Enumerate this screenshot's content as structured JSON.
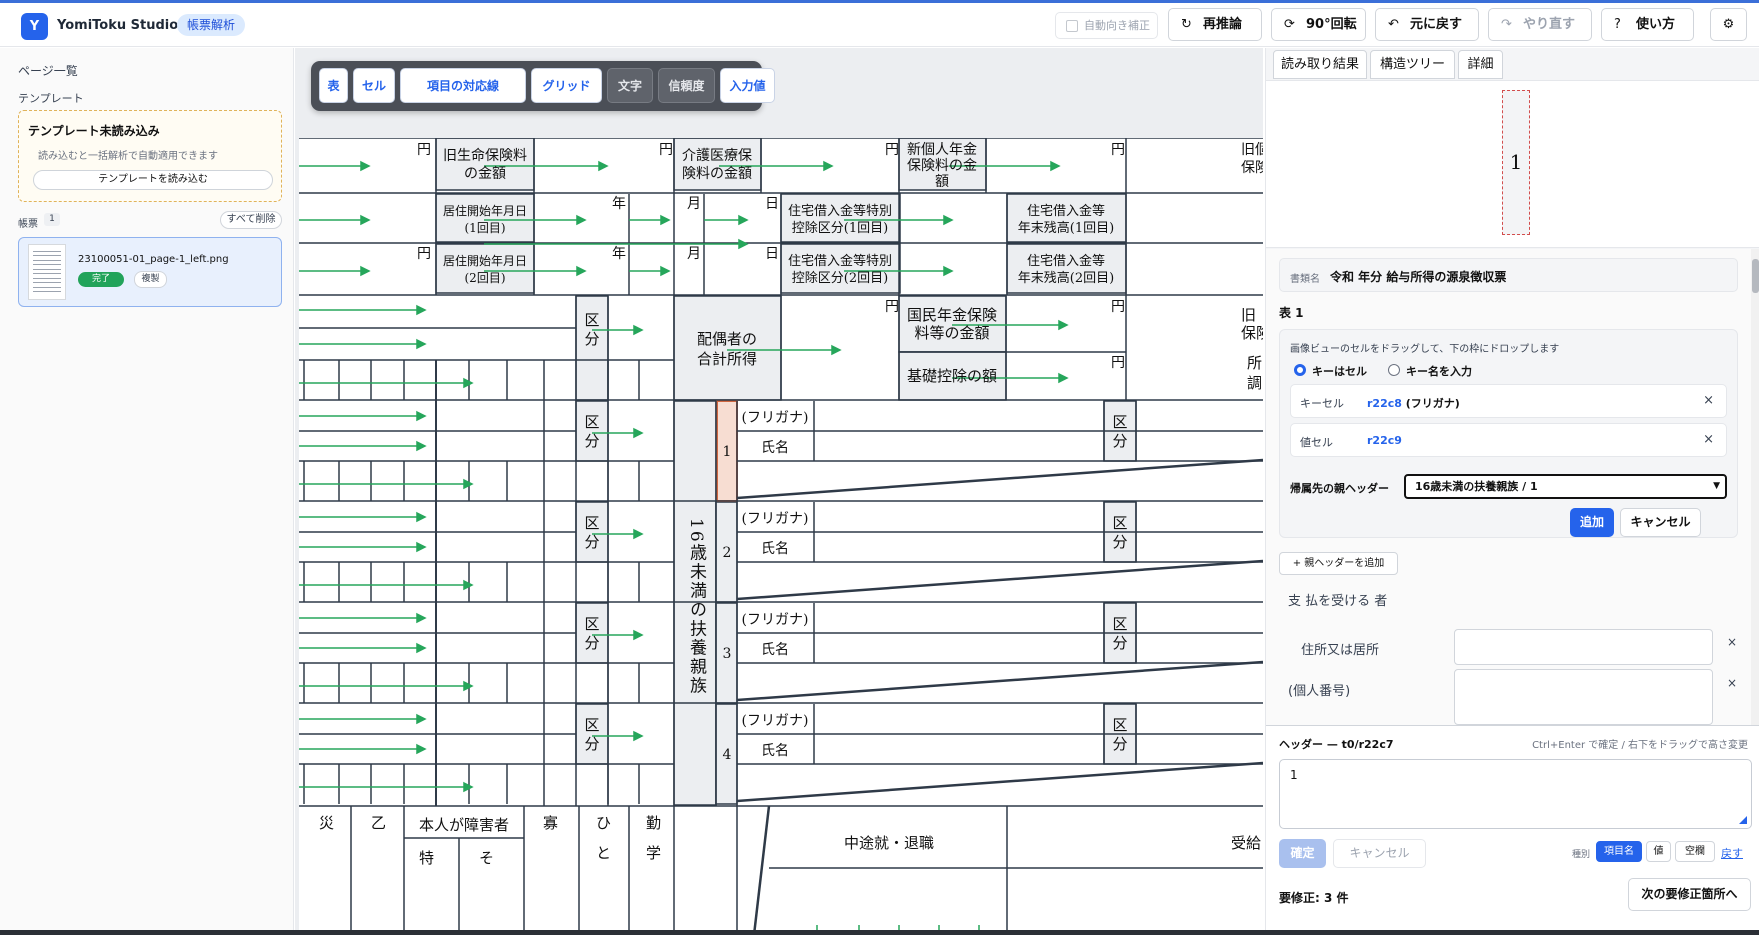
{
  "app": {
    "logo": "Y",
    "title": "YomiToku Studio",
    "mode": "帳票解析"
  },
  "toolbar": {
    "auto_rotate": "自動向き補正",
    "reinfer": "再推論",
    "reinfer_icon": "↻",
    "rotate": "90°回転",
    "rotate_icon": "⟳",
    "undo": "元に戻す",
    "undo_icon": "↶",
    "redo": "やり直す",
    "redo_icon": "↷",
    "help": "使い方",
    "help_icon": "?",
    "settings_icon": "⚙"
  },
  "left": {
    "page_list": "ページ一覧",
    "template_heading": "テンプレート",
    "template_title": "テンプレート未読み込み",
    "template_desc": "読み込むと一括解析で自動適用できます",
    "template_load": "テンプレートを読み込む",
    "forms_label": "帳票",
    "forms_count": "1",
    "clear_all": "すべて削除",
    "file": {
      "name": "23100051-01_page-1_left.png",
      "status": "完了",
      "duplicate": "複製"
    }
  },
  "overlay": [
    "表",
    "セル",
    "項目の対応線",
    "グリッド",
    "文字",
    "信頼度",
    "入力値"
  ],
  "doc": {
    "yen": "円",
    "year": "年",
    "month": "月",
    "day": "日",
    "old_life": [
      "旧生命保険料",
      "の金額"
    ],
    "care": [
      "介護医療保",
      "険料の金額"
    ],
    "new_pension": [
      "新個人年金",
      "保険料の金",
      "額"
    ],
    "old_cut": [
      "旧個",
      "保険"
    ],
    "start1": [
      "居住開始年月日",
      "(1回目)"
    ],
    "start2": [
      "居住開始年月日",
      "(2回目)"
    ],
    "loan_cat1": [
      "住宅借入金等特別",
      "控除区分(1回目)"
    ],
    "loan_cat2": [
      "住宅借入金等特別",
      "控除区分(2回目)"
    ],
    "loan_bal1": [
      "住宅借入金等",
      "年末残高(1回目)"
    ],
    "loan_bal2": [
      "住宅借入金等",
      "年末残高(2回目)"
    ],
    "kubun": [
      "区",
      "分"
    ],
    "spouse_income": [
      "配偶者の",
      "合計所得"
    ],
    "national_pension": [
      "国民年金保険",
      "料等の金額"
    ],
    "old_cut2": [
      "旧",
      "保険"
    ],
    "basic_deduction": "基礎控除の額",
    "adjust_cut": [
      "所",
      "調"
    ],
    "furigana": "(フリガナ)",
    "name": "氏名",
    "dependents_vertical": "16歳未満の扶養親族",
    "rows": [
      "1",
      "2",
      "3",
      "4"
    ],
    "bottom": {
      "disaster": "災",
      "otsu": "乙",
      "disabled": "本人が障害者",
      "widow": "寡",
      "hito": "ひ",
      "work": "勤",
      "midterm": "中途就・退職",
      "receive": "受給",
      "toku": "特",
      "sono": "そ",
      "to": "と",
      "gaku": "学"
    }
  },
  "right": {
    "tabs": [
      "読み取り結果",
      "構造ツリー",
      "詳細"
    ],
    "preview_value": "1",
    "doc_type_label": "書類名",
    "doc_type_value": "令和 年分 給与所得の源泉徴収票",
    "table_title": "表 1",
    "hint": "画像ビューのセルをドラッグして、下の枠にドロップします",
    "radio_cell": "キーはセル",
    "radio_name": "キー名を入力",
    "key_label": "キーセル",
    "key_id": "r22c8",
    "key_text": " (フリガナ)",
    "value_label": "値セル",
    "value_id": "r22c9",
    "clear": "×",
    "parent_label": "帰属先の親ヘッダー",
    "parent_value": "16歳未満の扶養親族 / 1",
    "add": "追加",
    "cancel": "キャンセル",
    "add_parent": "+ 親ヘッダーを追加",
    "section": "支 払を受ける 者",
    "kv1": "住所又は居所",
    "kv2": "(個人番号)",
    "header_label": "ヘッダー — t0/r22c7",
    "header_hint": "Ctrl+Enter で確定 / 右下をドラッグで高さ変更",
    "header_text": "1",
    "confirm": "確定",
    "cancel2": "キャンセル",
    "kind_label": "種別",
    "kind": [
      "項目名",
      "値",
      "空欄"
    ],
    "back": "戻す",
    "pending": "要修正: 3 件",
    "next": "次の要修正箇所へ"
  }
}
